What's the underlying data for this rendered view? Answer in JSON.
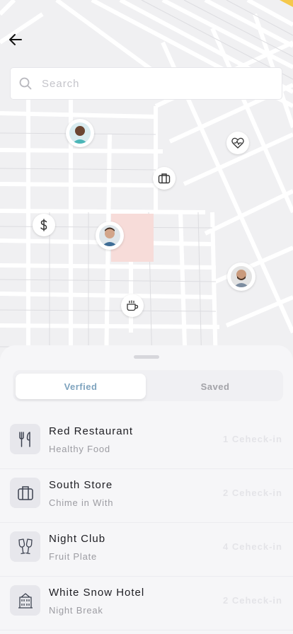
{
  "search": {
    "placeholder": "Search"
  },
  "map_markers": {
    "person_1": "avatar",
    "person_2": "avatar",
    "person_3": "avatar",
    "money": "dollar-icon",
    "shop": "briefcase-icon",
    "health": "heart-pulse-icon",
    "cafe": "coffee-icon"
  },
  "tabs": {
    "verified": "Verfied",
    "saved": "Saved"
  },
  "colors": {
    "accent": "#7ea3be",
    "highlight_block": "#f7dcd9"
  },
  "places": [
    {
      "title": "Red Restaurant",
      "subtitle": "Healthy Food",
      "count": "1 Ceheck-in",
      "icon": "cutlery-icon"
    },
    {
      "title": "South Store",
      "subtitle": "Chime in With",
      "count": "2 Ceheck-in",
      "icon": "briefcase-icon"
    },
    {
      "title": "Night Club",
      "subtitle": "Fruit Plate",
      "count": "4 Ceheck-in",
      "icon": "champagne-glasses-icon"
    },
    {
      "title": "White Snow Hotel",
      "subtitle": "Night Break",
      "count": "2 Ceheck-in",
      "icon": "hotel-icon"
    }
  ]
}
